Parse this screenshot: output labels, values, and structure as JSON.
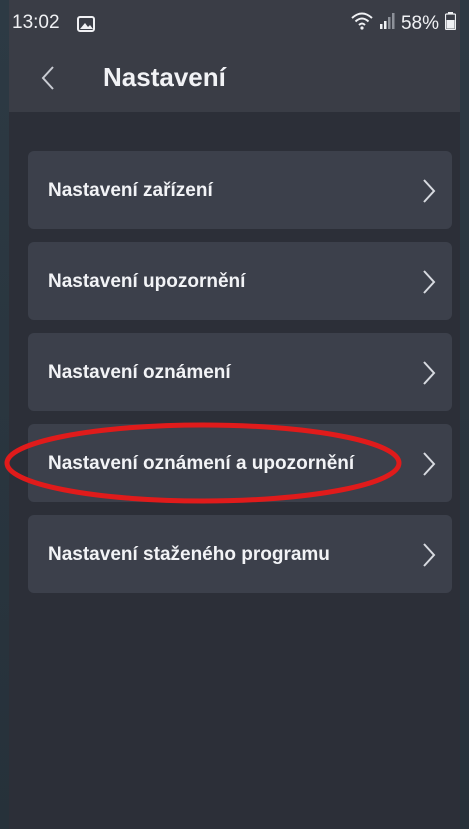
{
  "status": {
    "time": "13:02",
    "battery_percent": "58%",
    "icons": [
      "image-icon",
      "wifi-icon",
      "signal-icon",
      "battery-icon"
    ]
  },
  "header": {
    "title": "Nastavení",
    "back_icon": "chevron-left-icon"
  },
  "settings": {
    "items": [
      {
        "label": "Nastavení zařízení"
      },
      {
        "label": "Nastavení upozornění"
      },
      {
        "label": "Nastavení oznámení"
      },
      {
        "label": "Nastavení oznámení a upozornění"
      },
      {
        "label": "Nastavení staženého programu"
      }
    ]
  },
  "annotation": {
    "color": "#e01b1b",
    "highlighted_item": "Nastavení oznámení a upozornění"
  },
  "colors": {
    "background": "#2c2f38",
    "card": "#3c404b",
    "header": "#3a3d46",
    "text": "#f2f3f6"
  }
}
